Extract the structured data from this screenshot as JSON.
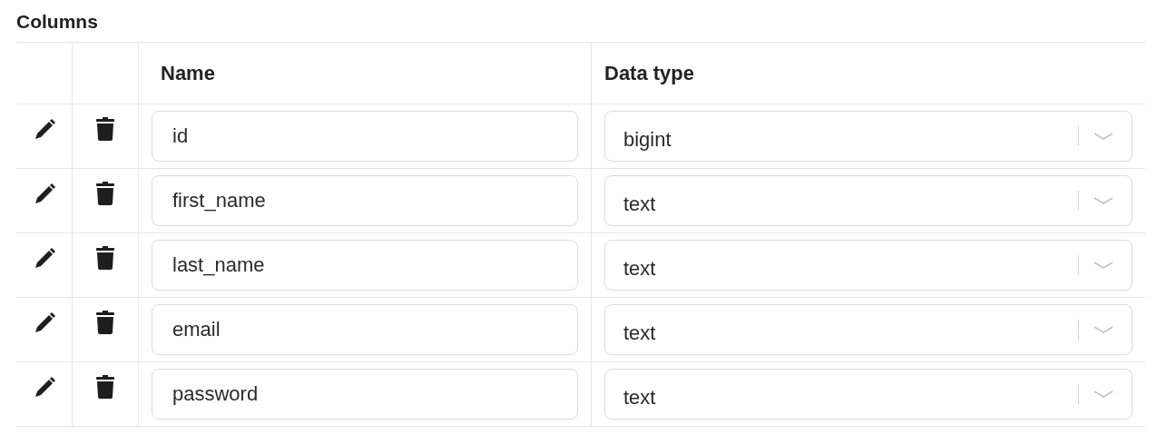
{
  "title": "Columns",
  "table": {
    "columns": [
      "Name",
      "Data type"
    ],
    "rows": [
      {
        "name": "id",
        "data_type": "bigint"
      },
      {
        "name": "first_name",
        "data_type": "text"
      },
      {
        "name": "last_name",
        "data_type": "text"
      },
      {
        "name": "email",
        "data_type": "text"
      },
      {
        "name": "password",
        "data_type": "text"
      }
    ]
  }
}
